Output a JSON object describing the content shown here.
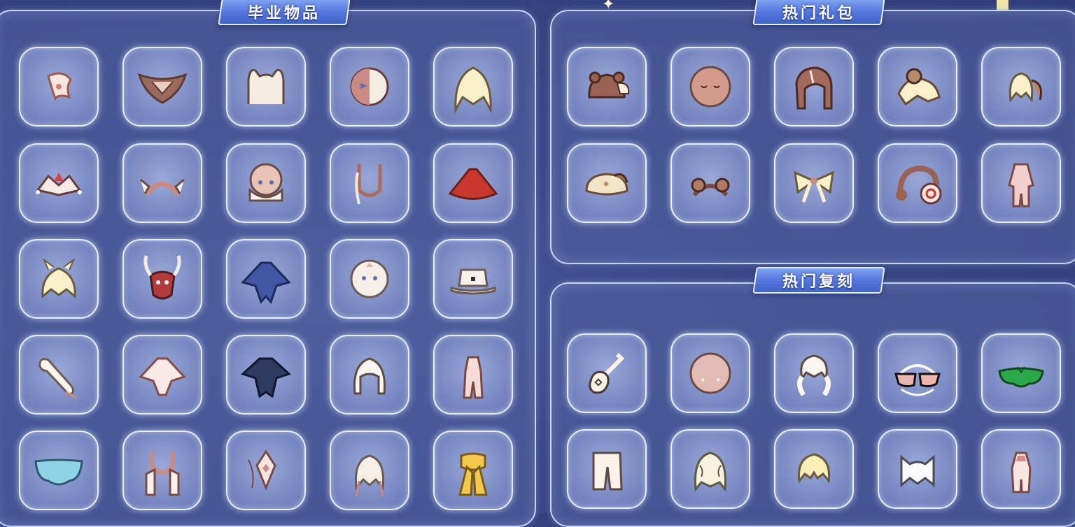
{
  "sections": {
    "graduation": {
      "title": "毕业物品"
    },
    "hot_gifts": {
      "title": "热门礼包"
    },
    "hot_rerun": {
      "title": "热门复刻"
    }
  },
  "graduation_items": [
    "pink-hair-clip-icon",
    "brown-wing-collar-icon",
    "white-ear-headpiece-icon",
    "half-mask-icon",
    "blonde-long-hair-icon",
    "jester-collar-icon",
    "winged-headband-icon",
    "bald-face-scarf-icon",
    "hair-strand-necklace-icon",
    "red-cape-icon",
    "horned-blonde-hair-icon",
    "horned-red-mask-icon",
    "blue-bat-cape-icon",
    "pale-face-mask-icon",
    "white-hat-icon",
    "white-trumpet-icon",
    "white-petal-cape-icon",
    "dark-bat-cape-icon",
    "white-bob-hair-icon",
    "pink-outfit-icon",
    "blue-butterfly-cape-icon",
    "pink-u-scarf-icon",
    "lantern-ornament-icon",
    "feathered-hair-icon",
    "golden-scarf-icon"
  ],
  "gift_items": [
    "bear-hat-icon",
    "sleepy-face-icon",
    "brown-hood-icon",
    "flying-squirrel-icon",
    "pigtail-hair-icon",
    "beret-hat-icon",
    "bear-ear-headband-icon",
    "cream-bow-icon",
    "brown-headphones-icon",
    "pink-pajama-outfit-icon"
  ],
  "rerun_items": [
    "ukulele-icon",
    "star-cheek-face-icon",
    "white-twin-hair-icon",
    "white-sunglasses-icon",
    "green-leaf-cape-icon",
    "white-pants-icon",
    "curly-hair-icon",
    "short-blonde-hair-icon",
    "white-cat-hat-icon",
    "pink-tank-outfit-icon"
  ],
  "colors": {
    "tab": "#5274dc",
    "slot": "#7a89c2",
    "panel_border": "#c7d4f6"
  }
}
